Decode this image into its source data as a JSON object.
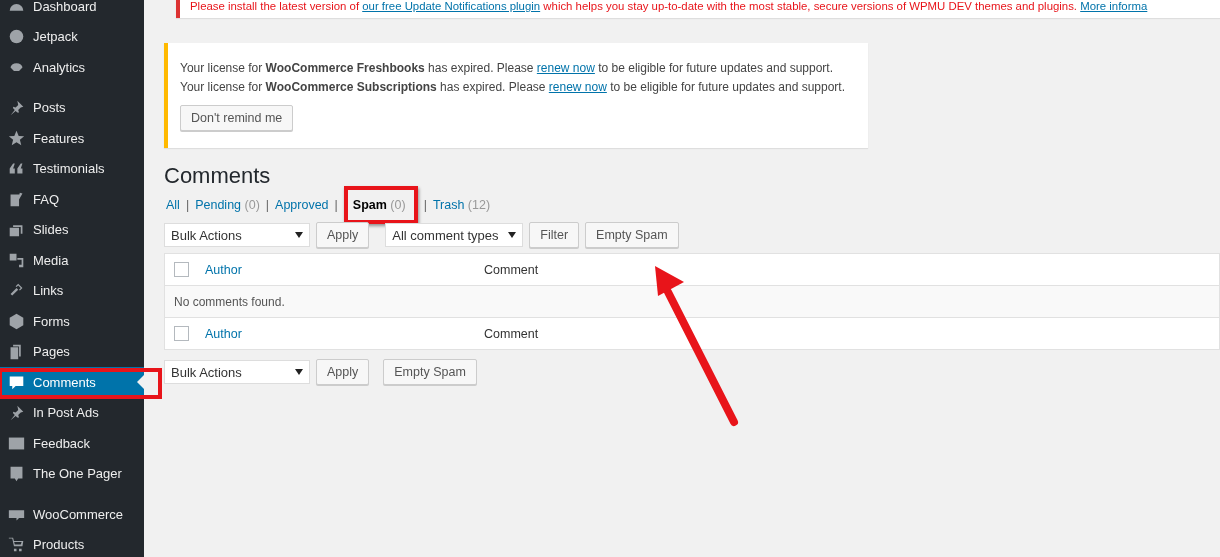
{
  "sidebar": {
    "groups": [
      {
        "items": [
          {
            "label": "Dashboard",
            "selected": false
          },
          {
            "label": "Jetpack",
            "selected": false
          },
          {
            "label": "Analytics",
            "selected": false
          }
        ]
      },
      {
        "items": [
          {
            "label": "Posts",
            "selected": false
          },
          {
            "label": "Features",
            "selected": false
          },
          {
            "label": "Testimonials",
            "selected": false
          },
          {
            "label": "FAQ",
            "selected": false
          },
          {
            "label": "Slides",
            "selected": false
          },
          {
            "label": "Media",
            "selected": false
          },
          {
            "label": "Links",
            "selected": false
          },
          {
            "label": "Forms",
            "selected": false
          },
          {
            "label": "Pages",
            "selected": false
          },
          {
            "label": "Comments",
            "selected": true
          },
          {
            "label": "In Post Ads",
            "selected": false
          },
          {
            "label": "Feedback",
            "selected": false
          },
          {
            "label": "The One Pager",
            "selected": false
          }
        ]
      },
      {
        "items": [
          {
            "label": "WooCommerce",
            "selected": false
          },
          {
            "label": "Products",
            "selected": false
          }
        ]
      }
    ]
  },
  "update_notice": {
    "before": "Please install the latest version of",
    "link": "our free Update Notifications plugin",
    "after": "which helps you stay up-to-date with the most stable, secure versions of WPMU DEV themes and plugins.",
    "more_link": "More informa"
  },
  "license_notice": {
    "lines": [
      {
        "before": "Your license for **WooCommerce Freshbooks** has expired. Please",
        "link": "renew now",
        "after": "to be eligible for future updates and support."
      },
      {
        "before": "Your license for **WooCommerce Subscriptions** has expired. Please",
        "link": "renew now",
        "after": "to be eligible for future updates and support."
      }
    ],
    "button": "Don't remind me"
  },
  "page_title": "Comments",
  "filters": [
    {
      "label": "All",
      "selected": false
    },
    {
      "separator": "|",
      "label": "Pending",
      "count": "(0)",
      "selected": false
    },
    {
      "separator": "|",
      "label": "Approved",
      "selected": false
    },
    {
      "separator": "|",
      "label": "Spam",
      "count": "(0)",
      "selected": true
    },
    {
      "separator": "|",
      "label": "Trash",
      "count": "(12)",
      "selected": false
    }
  ],
  "top_actions": {
    "bulk_select": "Bulk Actions",
    "apply": "Apply",
    "type_select": "All comment types",
    "filter": "Filter",
    "empty": "Empty Spam"
  },
  "table": {
    "header": [
      "Author",
      "Comment"
    ],
    "header_checked": false,
    "empty_message": "No comments found.",
    "footer": [
      "Author",
      "Comment"
    ],
    "footer_checked": false
  },
  "bottom_actions": {
    "bulk_select": "Bulk Actions",
    "apply": "Apply",
    "empty": "Empty Spam"
  }
}
